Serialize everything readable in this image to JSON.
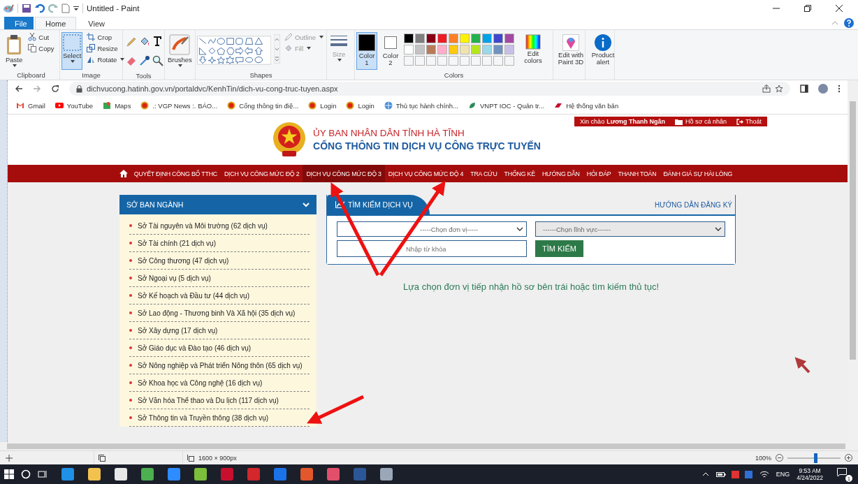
{
  "window": {
    "title": "Untitled - Paint"
  },
  "ribbon_tabs": [
    {
      "label": "File",
      "kind": "file",
      "selected": false
    },
    {
      "label": "Home",
      "kind": "tab",
      "selected": true
    },
    {
      "label": "View",
      "kind": "tab",
      "selected": false
    }
  ],
  "clipboard": {
    "paste": "Paste",
    "cut": "Cut",
    "copy": "Copy",
    "group_label": "Clipboard"
  },
  "image": {
    "select": {
      "label": "Select",
      "selected": true
    },
    "crop": "Crop",
    "resize": "Resize",
    "rotate": "Rotate",
    "group_label": "Image"
  },
  "tools": {
    "group_label": "Tools"
  },
  "brushes": {
    "label": "Brushes"
  },
  "shapes": {
    "outline": "Outline",
    "fill": "Fill",
    "group_label": "Shapes"
  },
  "size": {
    "label": "Size"
  },
  "colors": {
    "color_1": {
      "label": "Color 1",
      "color": "#000000",
      "selected": true
    },
    "color_2": {
      "label": "Color 2",
      "color": "#ffffff",
      "selected": false
    },
    "palette": [
      {
        "color": "#000000"
      },
      {
        "color": "#7f7f7f"
      },
      {
        "color": "#880015"
      },
      {
        "color": "#ed1c24"
      },
      {
        "color": "#ff7f27"
      },
      {
        "color": "#fff200"
      },
      {
        "color": "#22b14c"
      },
      {
        "color": "#00a2e8"
      },
      {
        "color": "#3f48cc"
      },
      {
        "color": "#a349a4"
      },
      {
        "color": "#ffffff"
      },
      {
        "color": "#c3c3c3"
      },
      {
        "color": "#b97a57"
      },
      {
        "color": "#ffaec9"
      },
      {
        "color": "#ffc90e"
      },
      {
        "color": "#efe4b0"
      },
      {
        "color": "#b5e61d"
      },
      {
        "color": "#99d9ea"
      },
      {
        "color": "#7092be"
      },
      {
        "color": "#c8bfe7"
      }
    ],
    "edit_colors": "Edit colors",
    "group_label": "Colors"
  },
  "paint3d": "Edit with Paint 3D",
  "product_alert": "Product alert",
  "browser": {
    "url": "dichvucong.hatinh.gov.vn/portaldvc/KenhTin/dich-vu-cong-truc-tuyen.aspx",
    "bookmarks": [
      {
        "label": "Gmail",
        "kind": "gmail"
      },
      {
        "label": "YouTube",
        "kind": "youtube"
      },
      {
        "label": "Maps",
        "kind": "maps"
      },
      {
        "label": ".: VGP News :. BÁO...",
        "kind": "emblem"
      },
      {
        "label": "Cổng thông tin điệ...",
        "kind": "emblem"
      },
      {
        "label": "Login",
        "kind": "emblem"
      },
      {
        "label": "Login",
        "kind": "emblem"
      },
      {
        "label": "Thủ tục hành chính...",
        "kind": "globe"
      },
      {
        "label": "VNPT IOC - Quản tr...",
        "kind": "leaf"
      },
      {
        "label": "Hệ thống văn bản",
        "kind": "mark"
      }
    ]
  },
  "site": {
    "greeting": "Xin chào **Lương Thanh Ngân**",
    "profile": "Hồ sơ cá nhân",
    "logout": "Thoát",
    "title_1": "ỦY BAN NHÂN DÂN TỈNH HÀ TĨNH",
    "title_2": "CỔNG THÔNG TIN DỊCH VỤ CÔNG TRỰC TUYẾN",
    "nav": [
      {
        "label": "QUYẾT ĐỊNH CÔNG BỐ TTHC",
        "selected": false
      },
      {
        "label": "DỊCH VỤ CÔNG MỨC ĐỘ 2",
        "selected": false
      },
      {
        "label": "DỊCH VỤ CÔNG MỨC ĐỘ 3",
        "selected": true
      },
      {
        "label": "DỊCH VỤ CÔNG MỨC ĐỘ 4",
        "selected": false
      },
      {
        "label": "TRA CỨU",
        "selected": false
      },
      {
        "label": "THỐNG KÊ",
        "selected": false
      },
      {
        "label": "HƯỚNG DẪN",
        "selected": false
      },
      {
        "label": "HỎI ĐÁP",
        "selected": false
      },
      {
        "label": "THANH TOÁN",
        "selected": false
      },
      {
        "label": "ĐÁNH GIÁ SỰ HÀI LÒNG",
        "selected": false
      }
    ],
    "sidebar": {
      "title": "SỞ BAN NGÀNH",
      "items": [
        "Sở Tài nguyên và Môi trường (62 dịch vụ)",
        "Sở Tài chính (21 dịch vụ)",
        "Sở Công thương (47 dịch vụ)",
        "Sở Ngoại vụ (5 dịch vụ)",
        "Sở Kế hoạch và Đầu tư (44 dịch vụ)",
        "Sở Lao động - Thương binh Và Xã hội (35 dịch vụ)",
        "Sở Xây dựng (17 dịch vụ)",
        "Sở Giáo dục và Đào tạo (46 dịch vụ)",
        "Sở Nông nghiệp và Phát triển Nông thôn (65 dịch vụ)",
        "Sở Khoa học và Công nghệ (16 dịch vụ)",
        "Sở Văn hóa Thể thao và Du lịch (117 dịch vụ)",
        "Sở Thông tin và Truyền thông (38 dịch vụ)"
      ]
    },
    "search": {
      "tab": "TÌM KIẾM DỊCH VỤ",
      "register_link": "HƯỚNG DẪN ĐĂNG KÝ",
      "unit_select": "-----Chọn đơn vị-----",
      "field_select": "------Chọn lĩnh vực------",
      "keyword": {
        "placeholder": "Nhập từ khóa"
      },
      "button": "TÌM KIẾM",
      "message": "Lựa chọn đơn vị tiếp nhận hồ sơ bên trái hoặc tìm kiếm thủ tục!"
    }
  },
  "status_bar": {
    "dimensions": "1600 × 900px",
    "zoom": "100%",
    "zoom_slider": {
      "level": 0.52
    }
  },
  "taskbar": {
    "language": "ENG",
    "time": "9:53 AM",
    "date": "4/24/2022",
    "notifications": "1"
  }
}
